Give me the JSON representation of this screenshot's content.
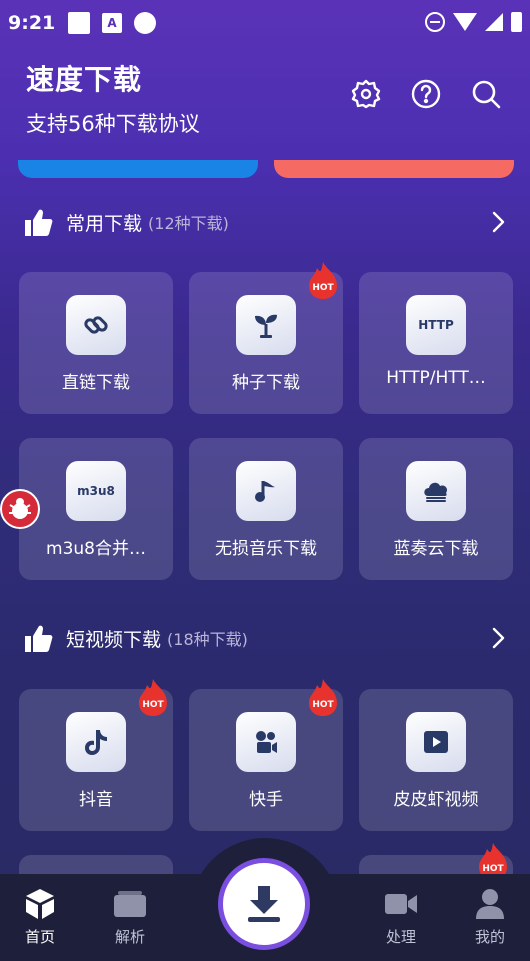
{
  "status_bar": {
    "time": "9:21"
  },
  "header": {
    "title": "速度下载",
    "subtitle": "支持56种下载协议"
  },
  "sections": [
    {
      "title": "常用下载",
      "count": "(12种下载)",
      "cards": [
        {
          "label": "直链下载",
          "icon": "link-icon",
          "hot": false
        },
        {
          "label": "种子下载",
          "icon": "sprout-icon",
          "hot": true
        },
        {
          "label": "HTTP/HTT…",
          "icon": "http-icon",
          "icon_text": "HTTP",
          "hot": false
        },
        {
          "label": "m3u8合并…",
          "icon": "m3u8-icon",
          "icon_text": "m3u8",
          "hot": false
        },
        {
          "label": "无损音乐下载",
          "icon": "music-note-icon",
          "hot": false
        },
        {
          "label": "蓝奏云下载",
          "icon": "cloud-icon",
          "hot": false
        }
      ]
    },
    {
      "title": "短视频下载",
      "count": "(18种下载)",
      "cards": [
        {
          "label": "抖音",
          "icon": "tiktok-icon",
          "hot": true
        },
        {
          "label": "快手",
          "icon": "kuaishou-icon",
          "hot": true
        },
        {
          "label": "皮皮虾视频",
          "icon": "play-icon",
          "hot": false
        }
      ]
    }
  ],
  "hot_badge": "HOT",
  "bottom_nav": [
    {
      "label": "首页",
      "icon": "cube-icon",
      "active": true
    },
    {
      "label": "解析",
      "icon": "folder-icon",
      "active": false
    },
    {
      "label": "处理",
      "icon": "video-camera-icon",
      "active": false
    },
    {
      "label": "我的",
      "icon": "user-icon",
      "active": false
    }
  ],
  "colors": {
    "accent": "#7a4fe0",
    "banner_blue": "#1a84e6",
    "banner_red": "#f56b63",
    "hot_red": "#e8322e"
  }
}
